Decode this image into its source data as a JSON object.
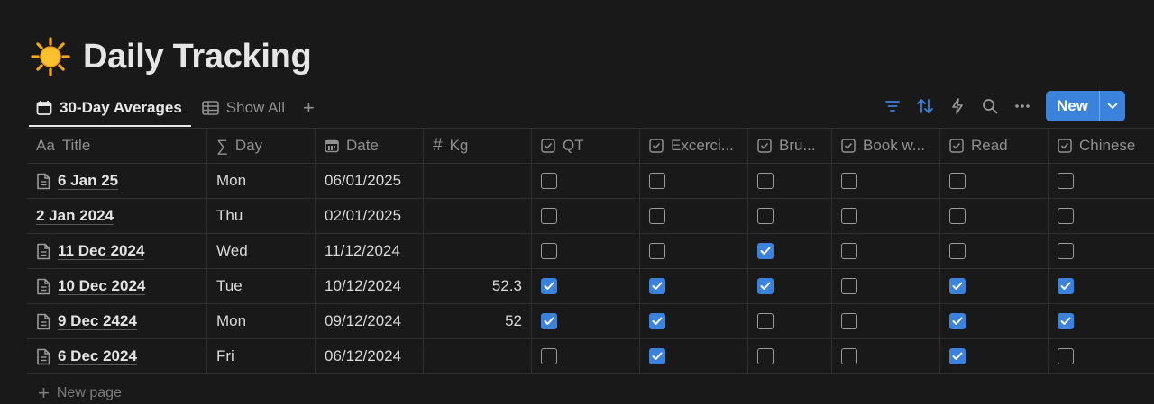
{
  "page": {
    "title": "Daily Tracking",
    "icon": "sun-emoji-icon"
  },
  "views": {
    "tabs": [
      {
        "label": "30-Day Averages",
        "icon": "calendar-icon",
        "active": true
      },
      {
        "label": "Show All",
        "icon": "table-icon",
        "active": false
      }
    ]
  },
  "toolbar": {
    "new_label": "New"
  },
  "columns": [
    {
      "label": "Title",
      "icon": "Aa"
    },
    {
      "label": "Day",
      "icon": "sigma-icon"
    },
    {
      "label": "Date",
      "icon": "calendar-icon"
    },
    {
      "label": "Kg",
      "icon": "hash-icon"
    },
    {
      "label": "QT",
      "icon": "checkbox-icon"
    },
    {
      "label": "Excerci...",
      "icon": "checkbox-icon"
    },
    {
      "label": "Bru...",
      "icon": "checkbox-icon"
    },
    {
      "label": "Book w...",
      "icon": "checkbox-icon"
    },
    {
      "label": "Read",
      "icon": "checkbox-icon"
    },
    {
      "label": "Chinese",
      "icon": "checkbox-icon"
    }
  ],
  "rows": [
    {
      "title": "6 Jan 25",
      "has_doc_icon": true,
      "day": "Mon",
      "date": "06/01/2025",
      "kg": "",
      "checks": [
        false,
        false,
        false,
        false,
        false,
        false
      ]
    },
    {
      "title": "2 Jan 2024",
      "has_doc_icon": false,
      "day": "Thu",
      "date": "02/01/2025",
      "kg": "",
      "checks": [
        false,
        false,
        false,
        false,
        false,
        false
      ]
    },
    {
      "title": "11 Dec 2024",
      "has_doc_icon": true,
      "day": "Wed",
      "date": "11/12/2024",
      "kg": "",
      "checks": [
        false,
        false,
        true,
        false,
        false,
        false
      ]
    },
    {
      "title": "10 Dec 2024",
      "has_doc_icon": true,
      "day": "Tue",
      "date": "10/12/2024",
      "kg": "52.3",
      "checks": [
        true,
        true,
        true,
        false,
        true,
        true
      ]
    },
    {
      "title": "9 Dec 2424",
      "has_doc_icon": true,
      "day": "Mon",
      "date": "09/12/2024",
      "kg": "52",
      "checks": [
        true,
        true,
        false,
        false,
        true,
        true
      ]
    },
    {
      "title": "6 Dec 2024",
      "has_doc_icon": true,
      "day": "Fri",
      "date": "06/12/2024",
      "kg": "",
      "checks": [
        false,
        true,
        false,
        false,
        true,
        false
      ]
    }
  ],
  "footer": {
    "new_page_label": "New page"
  },
  "colors": {
    "background": "#191919",
    "accent": "#3a82dc",
    "border": "#2f2f2f"
  }
}
